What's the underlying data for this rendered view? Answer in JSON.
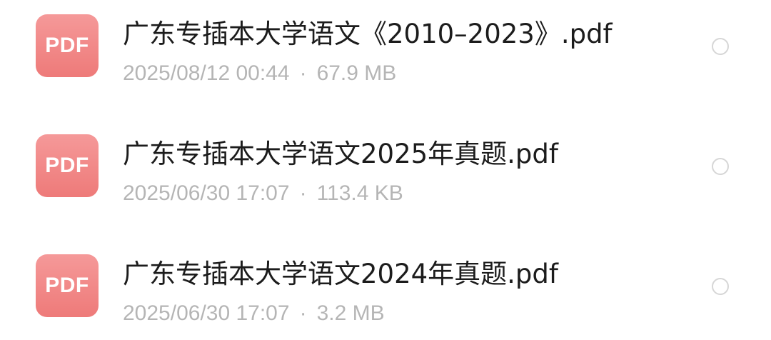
{
  "files": [
    {
      "icon_label": "PDF",
      "name": "广东专插本大学语文《2010–2023》.pdf",
      "date": "2025/08/12 00:44",
      "separator": "·",
      "size": "67.9 MB",
      "selected": false
    },
    {
      "icon_label": "PDF",
      "name": "广东专插本大学语文2025年真题.pdf",
      "date": "2025/06/30 17:07",
      "separator": "·",
      "size": "113.4 KB",
      "selected": false
    },
    {
      "icon_label": "PDF",
      "name": "广东专插本大学语文2024年真题.pdf",
      "date": "2025/06/30 17:07",
      "separator": "·",
      "size": "3.2 MB",
      "selected": false
    }
  ],
  "colors": {
    "icon_top": "#f59999",
    "icon_bottom": "#ee7a79",
    "title": "#1c1c1c",
    "meta": "#b5b5b5",
    "radio_border": "#d6d6d6"
  }
}
